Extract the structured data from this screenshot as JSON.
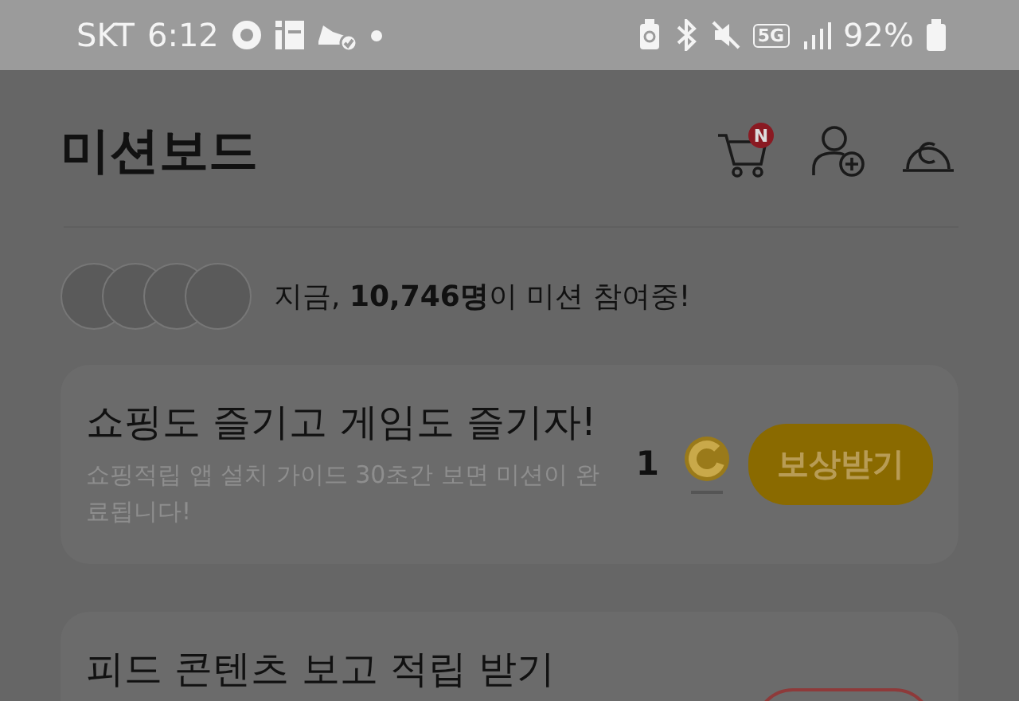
{
  "status_bar": {
    "carrier": "SKT",
    "time": "6:12",
    "network": "5G",
    "battery": "92%"
  },
  "header": {
    "title": "미션보드",
    "cart_badge": "N"
  },
  "participants": {
    "text": "지금, **10,746명**이 미션 참여중!"
  },
  "missions": [
    {
      "kind": "claim",
      "title": "쇼핑도 즐기고 게임도 즐기자!",
      "description": "쇼핑적립 앱 설치 가이드 30초간 보면 미션이 완료됩니다!",
      "reward": "1",
      "button": "보상받기"
    },
    {
      "kind": "pending",
      "title": "피드 콘텐츠 보고 적립 받기"
    }
  ]
}
